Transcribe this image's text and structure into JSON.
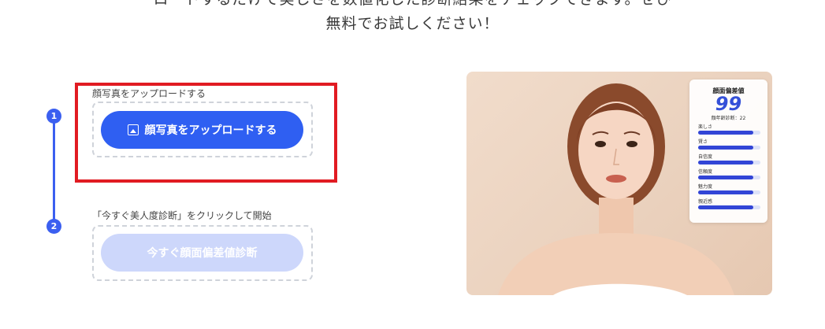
{
  "intro": {
    "line1": "ロードするだけで美しさを数値化した診断結果をチェックできます。ぜひ",
    "line2": "無料でお試しください！"
  },
  "steps": [
    {
      "number": "1",
      "label": "顔写真をアップロードする",
      "button": "顔写真をアップロードする",
      "button_icon": "image-icon"
    },
    {
      "number": "2",
      "label": "「今すぐ美人度診断」をクリックして開始",
      "button": "今すぐ顔面偏差値診断"
    }
  ],
  "colors": {
    "accent": "#2f5ff2",
    "highlight": "#e11b22",
    "disabled_button": "#cdd7fb"
  },
  "result": {
    "title": "顔面偏差値",
    "score": "99",
    "age_line": "顔年齢診断：22",
    "metrics": [
      {
        "label": "楽しさ",
        "fill": 0.88
      },
      {
        "label": "賢さ",
        "fill": 0.88
      },
      {
        "label": "自信度",
        "fill": 0.88
      },
      {
        "label": "信頼度",
        "fill": 0.88
      },
      {
        "label": "魅力度",
        "fill": 0.88
      },
      {
        "label": "親近感",
        "fill": 0.88
      }
    ]
  }
}
